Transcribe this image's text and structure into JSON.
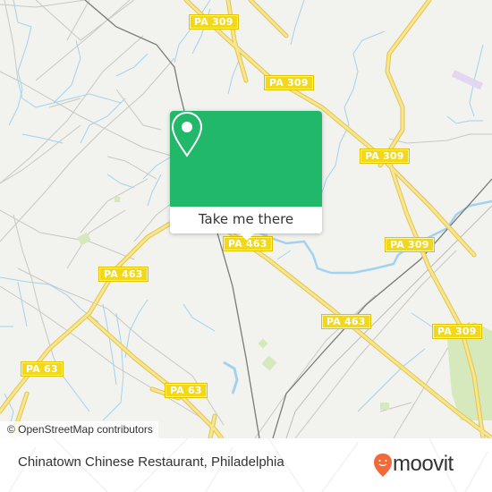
{
  "map": {
    "colors": {
      "background": "#f2f2ef",
      "highway": "#f5e07a",
      "highway_edge": "#e6c94a",
      "minor_road": "#c8c6c0",
      "water": "#9fd0ec",
      "park": "#d4e8b8",
      "railway": "#777777"
    },
    "shields": [
      {
        "label": "PA 309"
      },
      {
        "label": "PA 309"
      },
      {
        "label": "PA 309"
      },
      {
        "label": "PA 309"
      },
      {
        "label": "PA 309"
      },
      {
        "label": "PA 463"
      },
      {
        "label": "PA 463"
      },
      {
        "label": "PA 463"
      },
      {
        "label": "PA 63"
      },
      {
        "label": "PA 63"
      }
    ],
    "attribution": "© OpenStreetMap contributors"
  },
  "popup": {
    "accent": "#22b86a",
    "icon": "location-pin-icon",
    "button_label": "Take me there"
  },
  "footer": {
    "place_title": "Chinatown Chinese Restaurant, Philadelphia",
    "brand_name": "moovit",
    "brand_icon": "moovit-pin-logo-icon",
    "brand_color": "#f26a3a"
  }
}
